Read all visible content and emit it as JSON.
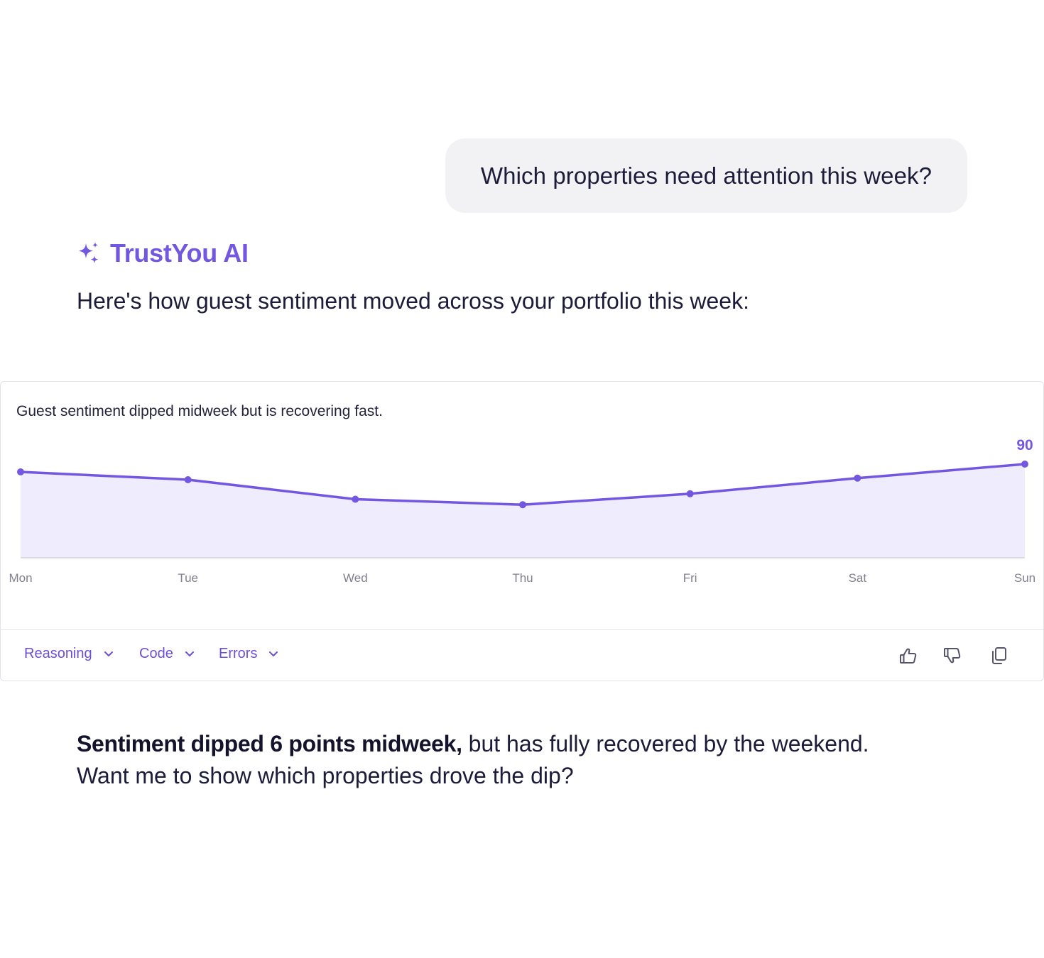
{
  "user_message": "Which properties need attention this week?",
  "assistant": {
    "name": "TrustYou AI",
    "icon": "sparkles-icon",
    "intro": "Here's how guest sentiment moved across your portfolio this week:"
  },
  "chart_card": {
    "caption": "Guest sentiment dipped midweek but is recovering fast.",
    "tabs": [
      {
        "label": "Reasoning",
        "icon": "chevron-down-icon"
      },
      {
        "label": "Code",
        "icon": "chevron-down-icon"
      },
      {
        "label": "Errors",
        "icon": "chevron-down-icon"
      }
    ],
    "actions": [
      "thumbs-up-icon",
      "thumbs-down-icon",
      "copy-icon"
    ]
  },
  "chart_data": {
    "type": "area",
    "categories": [
      "Mon",
      "Tue",
      "Wed",
      "Thu",
      "Fri",
      "Sat",
      "Sun"
    ],
    "values": [
      89,
      88,
      85.5,
      84.8,
      86.2,
      88.2,
      90
    ],
    "ylim": [
      78,
      92
    ],
    "last_value_label": "90",
    "grid": false,
    "colors": {
      "line": "#7357e0",
      "fill": "#efecfd",
      "axis": "#d4d4dc",
      "tick": "#808090"
    }
  },
  "summary": {
    "bold": "Sentiment dipped 6 points midweek,",
    "rest": "but has fully recovered by the weekend.",
    "line2": "Want me to show which properties drove the dip?"
  }
}
